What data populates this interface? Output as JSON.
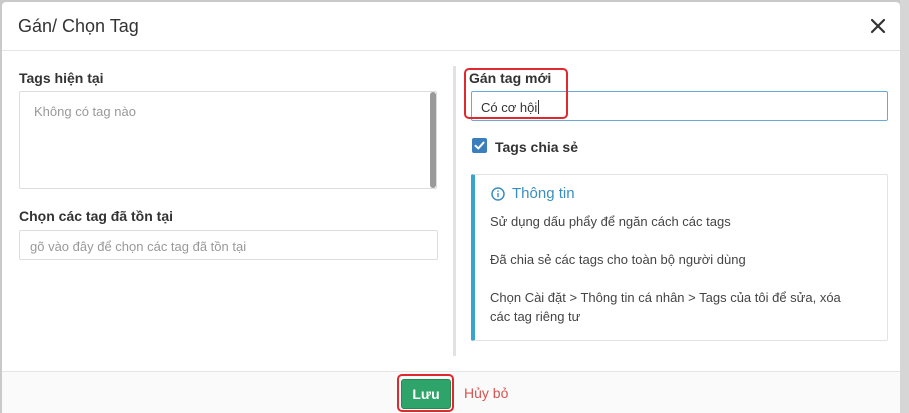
{
  "modal": {
    "title": "Gán/ Chọn Tag"
  },
  "left": {
    "current_tags_label": "Tags hiện tại",
    "current_tags_empty": "Không có tag nào",
    "existing_tags_label": "Chọn các tag đã tồn tại",
    "existing_tags_placeholder": "gõ vào đây để chọn các tag đã tồn tại"
  },
  "right": {
    "new_tag_label": "Gán tag mới",
    "new_tag_value": "Có cơ hội",
    "shared_checkbox_label": "Tags chia sẻ",
    "shared_checked": true
  },
  "info": {
    "title": "Thông tin",
    "lines": [
      "Sử dụng dấu phẩy để ngăn cách các tags",
      "Đã chia sẻ các tags cho toàn bộ người dùng",
      "Chọn Cài đặt > Thông tin cá nhân > Tags của tôi để sửa, xóa",
      "các tag riêng tư"
    ]
  },
  "footer": {
    "save_label": "Lưu",
    "cancel_label": "Hủy bỏ"
  },
  "icons": {
    "close": "close-icon",
    "info": "info-icon",
    "check": "check-icon"
  },
  "colors": {
    "save_green": "#2ea36a",
    "cancel_red": "#d9534f",
    "accent_blue": "#3a7ebd",
    "highlight_red": "#e0292e"
  }
}
